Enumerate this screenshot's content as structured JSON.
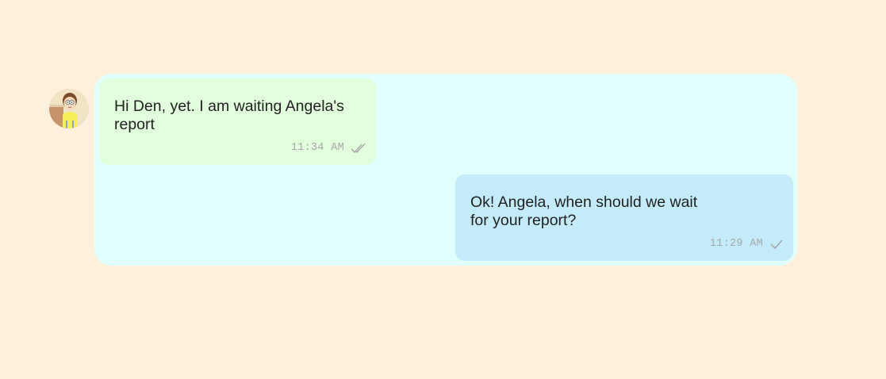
{
  "chat": {
    "contact": {
      "avatar_icon": "user-avatar-icon"
    },
    "messages": [
      {
        "direction": "incoming",
        "text": "Hi Den, yet. I am waiting Angela's report",
        "time": "11:34 AM",
        "status": "read",
        "status_icon": "double-check-icon"
      },
      {
        "direction": "outgoing",
        "text": "Ok! Angela, when should we wait for your report?",
        "time": "11:29 AM",
        "status": "sent",
        "status_icon": "single-check-icon"
      }
    ]
  },
  "colors": {
    "page_background": "#fff0dc",
    "chat_panel": "#e1ffff",
    "incoming_bubble": "#e1ffdc",
    "outgoing_bubble": "#c4ebf9",
    "meta_text": "#a8a8a8"
  }
}
